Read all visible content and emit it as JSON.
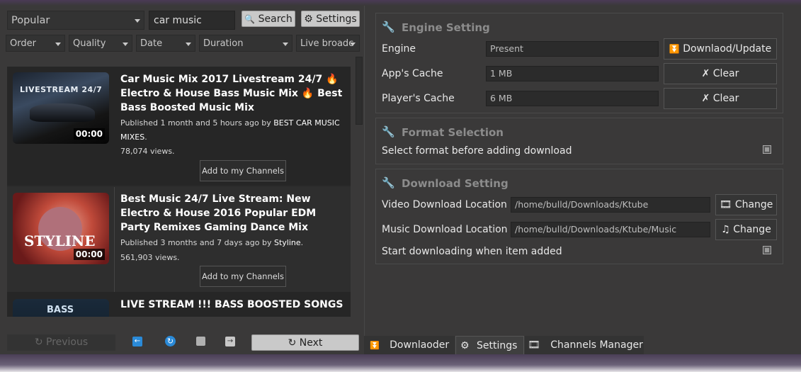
{
  "search": {
    "category": "Popular",
    "query": "car music",
    "search_label": "Search",
    "settings_label": "Settings"
  },
  "filters": [
    "Order",
    "Quality",
    "Date",
    "Duration",
    "Live broadc"
  ],
  "videos": [
    {
      "thumb_text": "LIVESTREAM 24/7",
      "duration": "00:00",
      "title": "Car Music Mix 2017 Livestream 24/7 🔥 Electro & House Bass Music Mix 🔥 Best Bass Boosted Music Mix",
      "published": "Published 1 month and 5 hours ago by",
      "author": "BEST CAR MUSIC MIXES",
      "views": "78,074 views.",
      "add_label": "Add to my Channels"
    },
    {
      "thumb_text": "STYLINE",
      "duration": "00:00",
      "title": "Best Music 24/7 Live Stream: New Electro & House 2016 Popular EDM Party Remixes Gaming Dance Mix",
      "published": "Published 3 months and 7 days ago by",
      "author": "Styline",
      "views": "561,903 views.",
      "add_label": "Add to my Channels"
    },
    {
      "thumb_text": "BASS",
      "duration": "",
      "title": "LIVE STREAM !!! BASS BOOSTED SONGS",
      "published": "",
      "author": "",
      "views": "",
      "add_label": ""
    }
  ],
  "pager": {
    "previous_label": "Previous",
    "next_label": "Next"
  },
  "engine": {
    "title": "Engine Setting",
    "engine_label": "Engine",
    "engine_value": "Present",
    "engine_button": "Downlaod/Update",
    "app_cache_label": "App's Cache",
    "app_cache_value": "1 MB",
    "player_cache_label": "Player's Cache",
    "player_cache_value": "6 MB",
    "clear_label": "Clear"
  },
  "format": {
    "title": "Format Selection",
    "select_label": "Select format before adding download"
  },
  "download": {
    "title": "Download Setting",
    "video_label": "Video Download Location",
    "video_path": "/home/bulld/Downloads/Ktube",
    "music_label": "Music Download Location",
    "music_path": "/home/bulld/Downloads/Ktube/Music",
    "change_label": "Change",
    "start_label": "Start downloading when item added"
  },
  "tabs": [
    "Downlaoder",
    "Settings",
    "Channels Manager"
  ],
  "colors": {
    "window_bg": "#3a3939",
    "list_bg": "#262626",
    "accent_blue": "#2a8ad8"
  }
}
